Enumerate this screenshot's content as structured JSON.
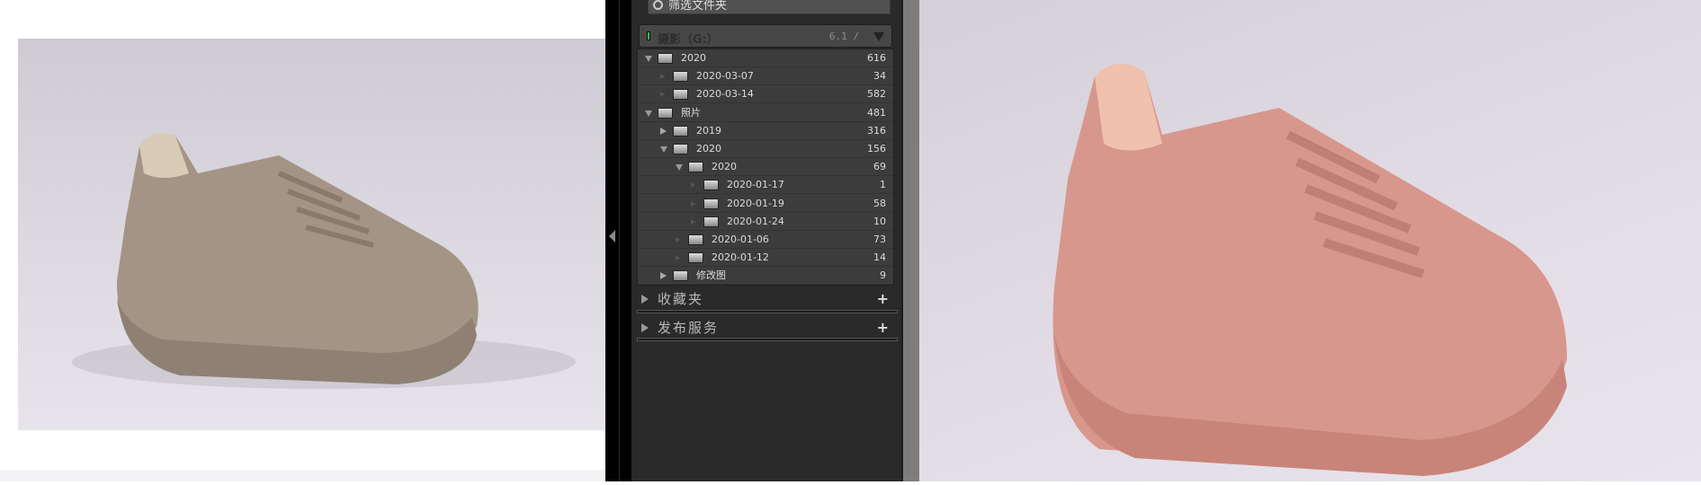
{
  "panel": {
    "search_placeholder": "筛选文件夹",
    "volume": {
      "name": "摄影（G:）",
      "size": "6.1 /",
      "status_color": "#3cbf3c"
    },
    "folders": [
      {
        "label": "2020",
        "count": "616",
        "level": 0,
        "state": "open"
      },
      {
        "label": "2020-03-07",
        "count": "34",
        "level": 1,
        "state": "empty"
      },
      {
        "label": "2020-03-14",
        "count": "582",
        "level": 1,
        "state": "empty"
      },
      {
        "label": "照片",
        "count": "481",
        "level": 0,
        "state": "open"
      },
      {
        "label": "2019",
        "count": "316",
        "level": 1,
        "state": "closed"
      },
      {
        "label": "2020",
        "count": "156",
        "level": 1,
        "state": "open"
      },
      {
        "label": "2020",
        "count": "69",
        "level": 2,
        "state": "open"
      },
      {
        "label": "2020-01-17",
        "count": "1",
        "level": 3,
        "state": "empty"
      },
      {
        "label": "2020-01-19",
        "count": "58",
        "level": 3,
        "state": "empty"
      },
      {
        "label": "2020-01-24",
        "count": "10",
        "level": 3,
        "state": "empty"
      },
      {
        "label": "2020-01-06",
        "count": "73",
        "level": 2,
        "state": "empty"
      },
      {
        "label": "2020-01-12",
        "count": "14",
        "level": 2,
        "state": "empty"
      },
      {
        "label": "修改图",
        "count": "9",
        "level": 1,
        "state": "closed"
      }
    ],
    "sections": [
      {
        "label": "收藏夹",
        "add": "+"
      },
      {
        "label": "发布服务",
        "add": "+"
      }
    ]
  },
  "colors": {
    "shoe_left": "#9e8f82",
    "shoe_right": "#d99a90"
  }
}
